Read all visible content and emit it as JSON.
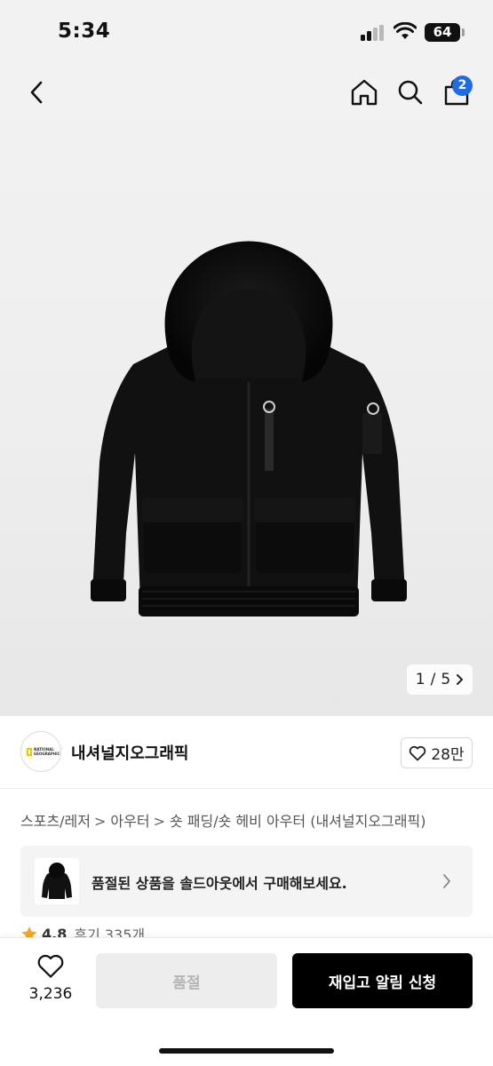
{
  "status_bar": {
    "time": "5:34",
    "battery": "64"
  },
  "nav": {
    "cart_count": "2"
  },
  "gallery": {
    "current": "1",
    "separator": "/",
    "total": "5"
  },
  "brand": {
    "name": "내셔널지오그래픽",
    "logo_text": "NATIONAL GEOGRAPHIC",
    "likes": "28만"
  },
  "breadcrumb": [
    "스포츠/레저",
    "아우터",
    "숏 패딩/숏 헤비 아우터 (내셔널지오그래픽)"
  ],
  "banner": {
    "text": "품절된 상품을 솔드아웃에서 구매해보세요."
  },
  "rating": {
    "score": "4.8",
    "reviews": "후기 335개"
  },
  "bottom": {
    "wish_count": "3,236",
    "soldout_label": "품절",
    "notify_label": "재입고 알림 신청"
  },
  "colors": {
    "accent": "#1e6be6",
    "primary_button": "#000000",
    "disabled_button": "#ededed",
    "logo_yellow": "#f5c400",
    "star": "#f5a623"
  }
}
